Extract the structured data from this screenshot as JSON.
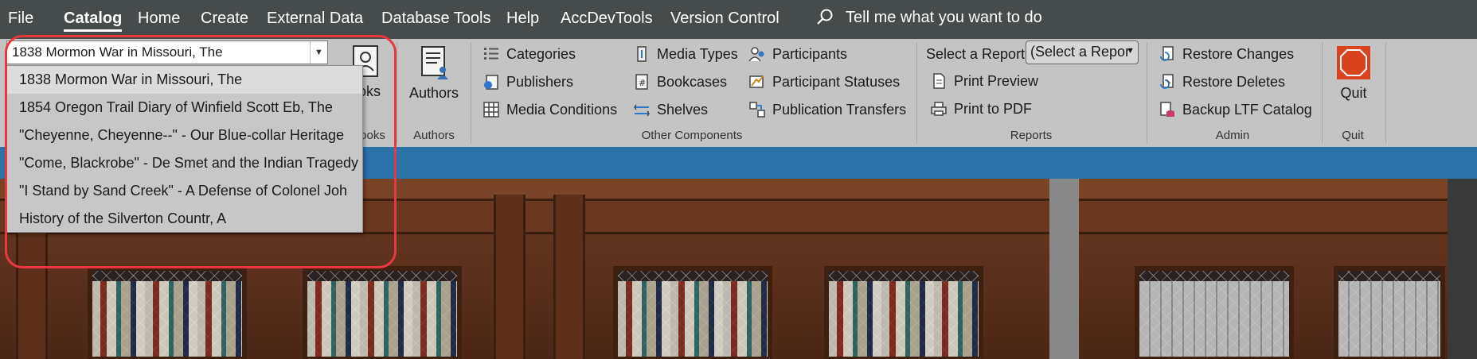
{
  "menu": {
    "items": [
      "File",
      "Catalog",
      "Home",
      "Create",
      "External Data",
      "Database Tools",
      "Help",
      "AccDevTools",
      "Version Control"
    ],
    "active": "Catalog",
    "tell_me": "Tell me what you want to do"
  },
  "ribbon": {
    "book_combo": {
      "value": "1838 Mormon War in Missouri, The"
    },
    "books_group": {
      "button_label": "ooks",
      "group_label": "ooks"
    },
    "authors_group": {
      "button_label": "Authors",
      "group_label": "Authors"
    },
    "other_components": {
      "group_label": "Other Components",
      "col1": [
        "Categories",
        "Publishers",
        "Media Conditions"
      ],
      "col2": [
        "Media Types",
        "Bookcases",
        "Shelves"
      ],
      "col3": [
        "Participants",
        "Participant Statuses",
        "Publication Transfers"
      ]
    },
    "reports": {
      "group_label": "Reports",
      "select_label": "Select a Report",
      "select_value": "(Select a Repor",
      "print_preview": "Print Preview",
      "print_pdf": "Print to PDF"
    },
    "admin": {
      "group_label": "Admin",
      "restore_changes": "Restore Changes",
      "restore_deletes": "Restore Deletes",
      "backup": "Backup LTF Catalog"
    },
    "quit": {
      "button_label": "Quit",
      "group_label": "Quit"
    }
  },
  "dropdown": {
    "items": [
      "1838 Mormon War in Missouri, The",
      "1854 Oregon Trail Diary of Winfield Scott Eb, The",
      "\"Cheyenne, Cheyenne--\" - Our Blue-collar Heritage",
      "\"Come, Blackrobe\" - De Smet and the Indian Tragedy",
      "\"I Stand by Sand Creek\" - A Defense of Colonel Joh",
      "History of the Silverton Countr, A"
    ],
    "selected_index": 0
  },
  "colors": {
    "menubar": "#464b4b",
    "ribbon": "#c4c4c4",
    "blueband": "#2b72a8",
    "highlight": "#e8373f",
    "quit_icon": "#d9431e"
  },
  "icons": {
    "search": "magnifier-icon",
    "categories": "list-icon",
    "publishers": "book-globe-icon",
    "media_conditions": "grid-icon",
    "media_types": "media-icon",
    "bookcases": "bookcase-icon",
    "shelves": "shelves-icon",
    "participants": "people-icon",
    "participant_statuses": "status-icon",
    "publication_transfers": "transfer-icon",
    "print_preview": "document-icon",
    "print_pdf": "printer-icon",
    "restore_changes": "restore-icon",
    "restore_deletes": "restore-delete-icon",
    "backup": "database-icon",
    "quit": "stop-sign-icon"
  }
}
